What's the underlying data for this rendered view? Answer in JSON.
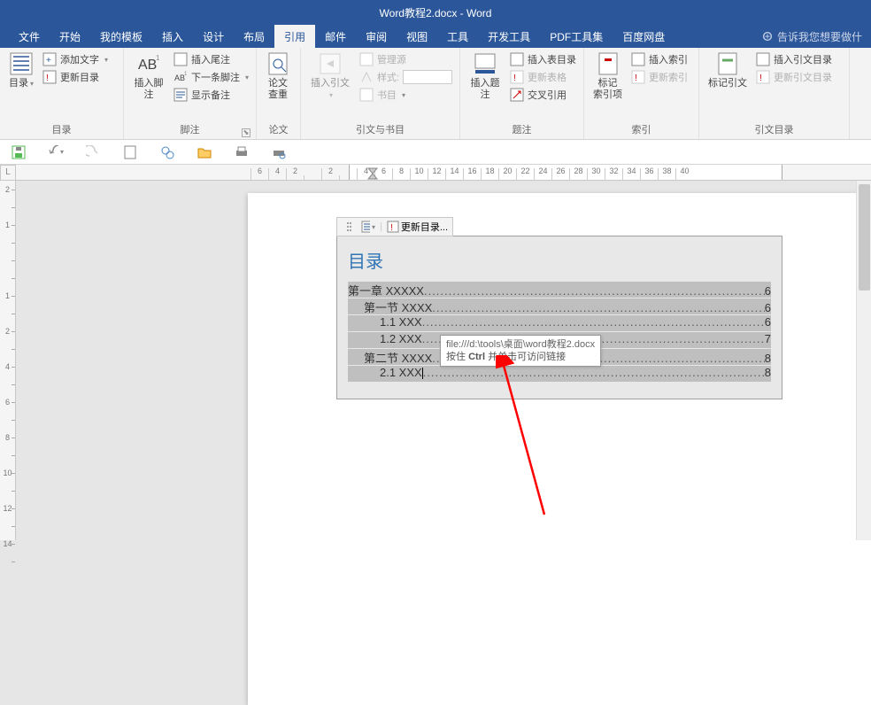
{
  "title": "Word教程2.docx - Word",
  "tabs": {
    "file": "文件",
    "home": "开始",
    "mytpl": "我的模板",
    "insert": "插入",
    "design": "设计",
    "layout": "布局",
    "references": "引用",
    "mailings": "邮件",
    "review": "审阅",
    "view": "视图",
    "tools": "工具",
    "developer": "开发工具",
    "pdf": "PDF工具集",
    "baidudisk": "百度网盘"
  },
  "tellme_placeholder": "告诉我您想要做什",
  "ribbon": {
    "toc": {
      "label": "目录",
      "add_text": "添加文字",
      "update_toc": "更新目录",
      "group": "目录"
    },
    "footnote": {
      "insert_footnote": "插入脚注",
      "insert_endnote": "插入尾注",
      "next_footnote": "下一条脚注",
      "show_notes": "显示备注",
      "group": "脚注"
    },
    "research": {
      "label": "论文\n查重",
      "group": "论文"
    },
    "citation": {
      "insert_citation": "插入引文",
      "manage_sources": "管理源",
      "style": "样式:",
      "bibliography": "书目",
      "group": "引文与书目"
    },
    "caption": {
      "insert_caption": "插入题注",
      "insert_fig_table": "插入表目录",
      "update_table": "更新表格",
      "cross_ref": "交叉引用",
      "group": "题注"
    },
    "index": {
      "mark_entry": "标记\n索引项",
      "insert_index": "插入索引",
      "update_index": "更新索引",
      "group": "索引"
    },
    "authorities": {
      "mark_citation": "标记引文",
      "insert_toa": "插入引文目录",
      "update_toa": "更新引文目录",
      "group": "引文目录"
    }
  },
  "toc_frame": {
    "update_btn": "更新目录...",
    "title": "目录",
    "lines": [
      {
        "indent": 0,
        "text": "第一章  XXXXX",
        "page": "6"
      },
      {
        "indent": 1,
        "text": "第一节  XXXX",
        "page": "6"
      },
      {
        "indent": 2,
        "text": "1.1 XXX",
        "page": "6"
      },
      {
        "indent": 2,
        "text": "1.2 XXX",
        "page": "7"
      },
      {
        "indent": 1,
        "text": "第二节  XXXX",
        "page": "8"
      },
      {
        "indent": 2,
        "text": "2.1 XXX",
        "page": "8"
      }
    ]
  },
  "tooltip": {
    "path": "file:///d:\\tools\\桌面\\word教程2.docx",
    "hint_pre": "按住 ",
    "hint_key": "Ctrl",
    "hint_post": " 并单击可访问链接"
  },
  "hruler_nums": [
    "6",
    "4",
    "2",
    "",
    "2",
    "",
    "4",
    "6",
    "8",
    "10",
    "12",
    "14",
    "16",
    "18",
    "20",
    "22",
    "24",
    "26",
    "28",
    "30",
    "32",
    "34",
    "36",
    "38",
    "40"
  ],
  "vruler_nums": [
    "2",
    "1",
    "",
    "1",
    "2",
    "4",
    "6",
    "8",
    "10",
    "12",
    "14"
  ]
}
